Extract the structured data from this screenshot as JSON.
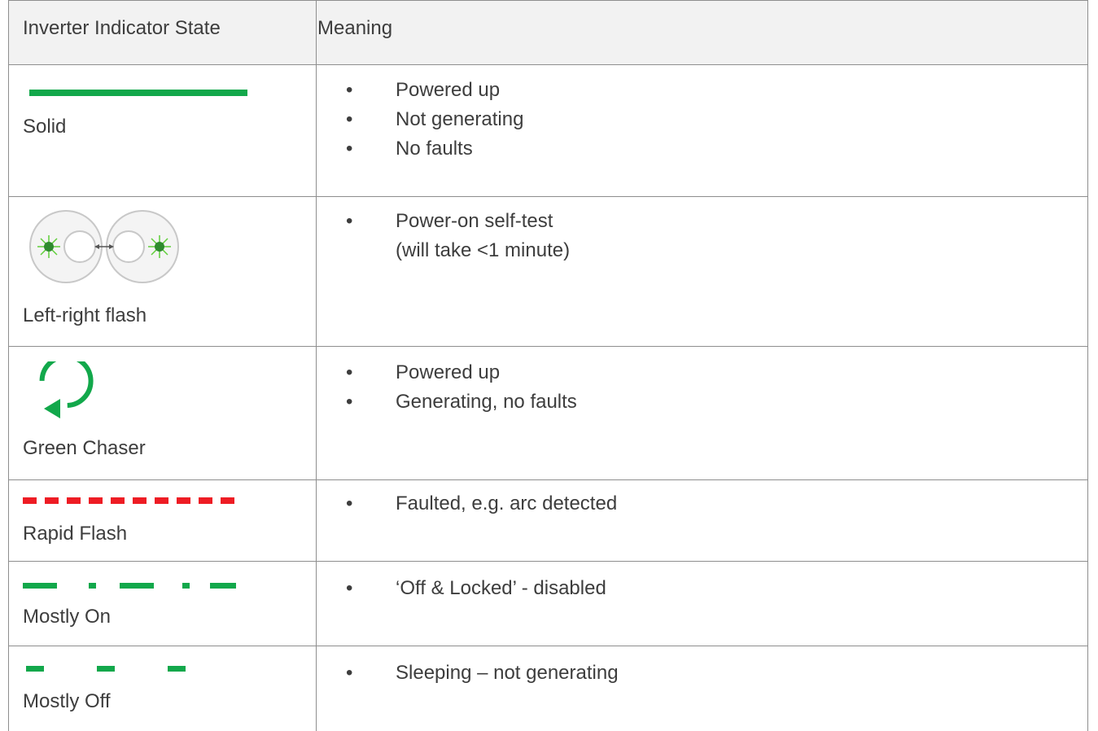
{
  "colors": {
    "green": "#12a84b",
    "red": "#ee1c24",
    "grid": "#8e8e8e",
    "header_bg": "#f2f2f2"
  },
  "header": {
    "state": "Inverter Indicator State",
    "meaning": "Meaning"
  },
  "rows": [
    {
      "state": "Solid",
      "indicator": "solid-green-line-icon",
      "meaning": [
        "Powered up",
        "Not generating",
        "No faults"
      ]
    },
    {
      "state": "Left-right flash",
      "indicator": "left-right-flash-icon",
      "meaning": [
        "Power-on self-test"
      ],
      "meaning_cont": "(will take <1 minute)"
    },
    {
      "state": "Green Chaser",
      "indicator": "green-chaser-icon",
      "meaning": [
        "Powered up",
        "Generating, no faults"
      ]
    },
    {
      "state": "Rapid Flash",
      "indicator": "red-dashed-line-icon",
      "meaning": [
        "Faulted, e.g. arc detected"
      ]
    },
    {
      "state": "Mostly On",
      "indicator": "mostly-on-dash-dot-icon",
      "meaning": [
        "‘Off & Locked’ - disabled"
      ]
    },
    {
      "state": "Mostly Off",
      "indicator": "mostly-off-dashes-icon",
      "meaning": [
        "Sleeping – not generating"
      ]
    }
  ]
}
